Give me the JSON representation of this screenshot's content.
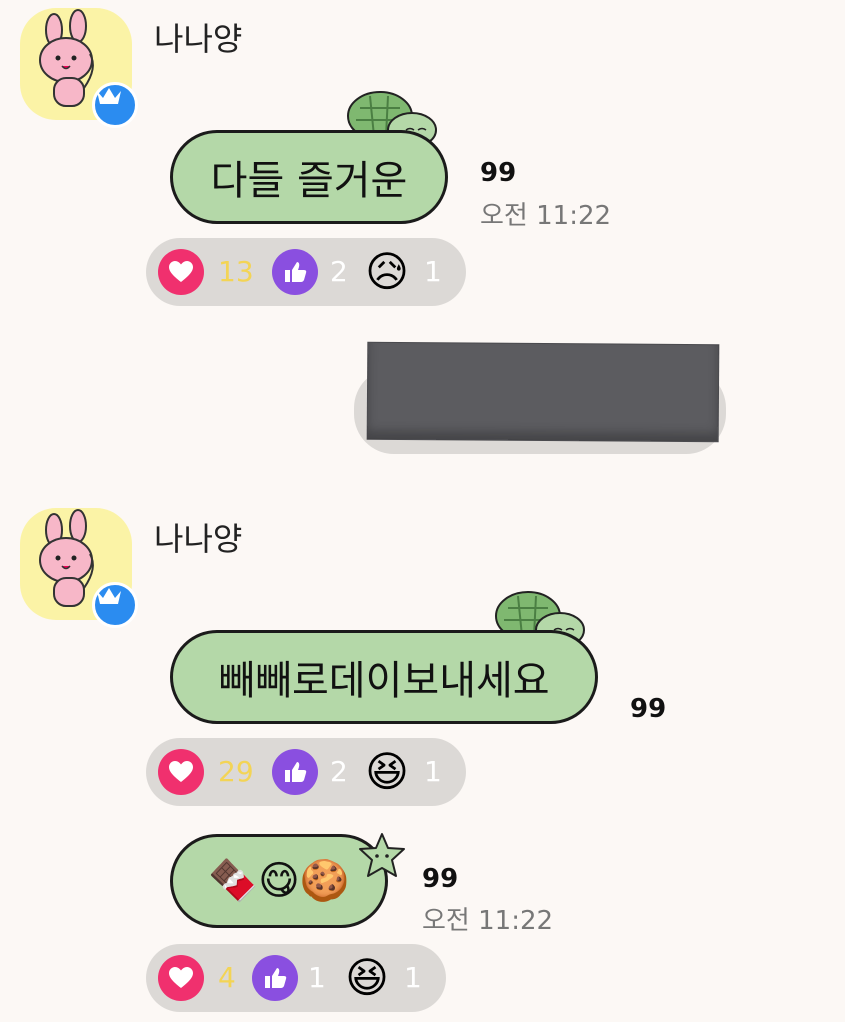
{
  "messages": [
    {
      "sender": "나나양",
      "text": "다들 즐거운",
      "count": "99",
      "time": "오전 11:22",
      "reactions": [
        {
          "icon": "heart-icon",
          "count": "13"
        },
        {
          "icon": "thumbs-up-icon",
          "count": "2"
        },
        {
          "icon": "sad-face-icon",
          "count": "1"
        }
      ]
    },
    {
      "type": "media",
      "description_icon": "image-attachment"
    },
    {
      "sender": "나나양",
      "text": "빼빼로데이보내세요",
      "count": "99",
      "reactions": [
        {
          "icon": "heart-icon",
          "count": "29"
        },
        {
          "icon": "thumbs-up-icon",
          "count": "2"
        },
        {
          "icon": "laughing-face-icon",
          "count": "1"
        }
      ]
    },
    {
      "text": "🍫😋🍪",
      "count": "99",
      "time": "오전 11:22",
      "reactions": [
        {
          "icon": "heart-icon",
          "count": "4"
        },
        {
          "icon": "thumbs-up-icon",
          "count": "1"
        },
        {
          "icon": "laughing-face-icon",
          "count": "1"
        }
      ]
    }
  ],
  "colors": {
    "background": "#fcf8f5",
    "bubble": "#b4d8a8",
    "reaction_bar": "#dcd9d6",
    "heart": "#f0306e",
    "thumbs_up": "#8a4fe0",
    "crown_badge": "#2b8cf0",
    "heart_count": "#f3d455"
  }
}
